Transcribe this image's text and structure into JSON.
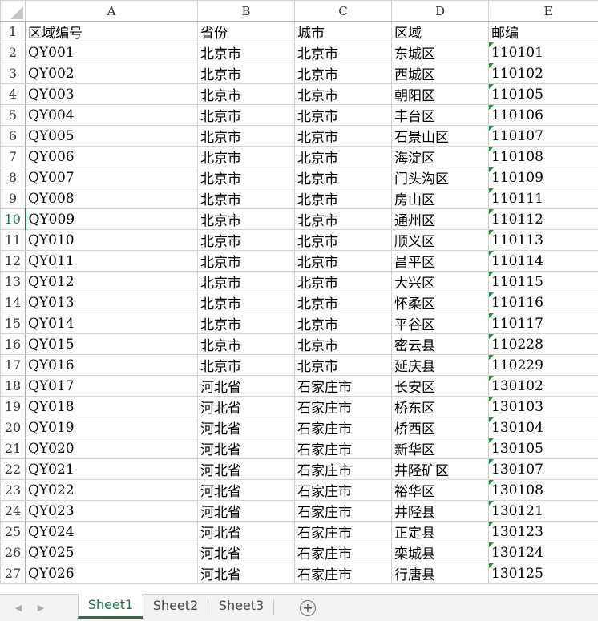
{
  "columns": [
    "A",
    "B",
    "C",
    "D",
    "E"
  ],
  "selected_row": "10",
  "rows": [
    {
      "num": "1",
      "cells": [
        "区域编号",
        "省份",
        "城市",
        "区域",
        "邮编"
      ]
    },
    {
      "num": "2",
      "cells": [
        "QY001",
        "北京市",
        "北京市",
        "东城区",
        "110101"
      ]
    },
    {
      "num": "3",
      "cells": [
        "QY002",
        "北京市",
        "北京市",
        "西城区",
        "110102"
      ]
    },
    {
      "num": "4",
      "cells": [
        "QY003",
        "北京市",
        "北京市",
        "朝阳区",
        "110105"
      ]
    },
    {
      "num": "5",
      "cells": [
        "QY004",
        "北京市",
        "北京市",
        "丰台区",
        "110106"
      ]
    },
    {
      "num": "6",
      "cells": [
        "QY005",
        "北京市",
        "北京市",
        "石景山区",
        "110107"
      ]
    },
    {
      "num": "7",
      "cells": [
        "QY006",
        "北京市",
        "北京市",
        "海淀区",
        "110108"
      ]
    },
    {
      "num": "8",
      "cells": [
        "QY007",
        "北京市",
        "北京市",
        "门头沟区",
        "110109"
      ]
    },
    {
      "num": "9",
      "cells": [
        "QY008",
        "北京市",
        "北京市",
        "房山区",
        "110111"
      ]
    },
    {
      "num": "10",
      "cells": [
        "QY009",
        "北京市",
        "北京市",
        "通州区",
        "110112"
      ]
    },
    {
      "num": "11",
      "cells": [
        "QY010",
        "北京市",
        "北京市",
        "顺义区",
        "110113"
      ]
    },
    {
      "num": "12",
      "cells": [
        "QY011",
        "北京市",
        "北京市",
        "昌平区",
        "110114"
      ]
    },
    {
      "num": "13",
      "cells": [
        "QY012",
        "北京市",
        "北京市",
        "大兴区",
        "110115"
      ]
    },
    {
      "num": "14",
      "cells": [
        "QY013",
        "北京市",
        "北京市",
        "怀柔区",
        "110116"
      ]
    },
    {
      "num": "15",
      "cells": [
        "QY014",
        "北京市",
        "北京市",
        "平谷区",
        "110117"
      ]
    },
    {
      "num": "16",
      "cells": [
        "QY015",
        "北京市",
        "北京市",
        "密云县",
        "110228"
      ]
    },
    {
      "num": "17",
      "cells": [
        "QY016",
        "北京市",
        "北京市",
        "延庆县",
        "110229"
      ]
    },
    {
      "num": "18",
      "cells": [
        "QY017",
        "河北省",
        "石家庄市",
        "长安区",
        "130102"
      ]
    },
    {
      "num": "19",
      "cells": [
        "QY018",
        "河北省",
        "石家庄市",
        "桥东区",
        "130103"
      ]
    },
    {
      "num": "20",
      "cells": [
        "QY019",
        "河北省",
        "石家庄市",
        "桥西区",
        "130104"
      ]
    },
    {
      "num": "21",
      "cells": [
        "QY020",
        "河北省",
        "石家庄市",
        "新华区",
        "130105"
      ]
    },
    {
      "num": "22",
      "cells": [
        "QY021",
        "河北省",
        "石家庄市",
        "井陉矿区",
        "130107"
      ]
    },
    {
      "num": "23",
      "cells": [
        "QY022",
        "河北省",
        "石家庄市",
        "裕华区",
        "130108"
      ]
    },
    {
      "num": "24",
      "cells": [
        "QY023",
        "河北省",
        "石家庄市",
        "井陉县",
        "130121"
      ]
    },
    {
      "num": "25",
      "cells": [
        "QY024",
        "河北省",
        "石家庄市",
        "正定县",
        "130123"
      ]
    },
    {
      "num": "26",
      "cells": [
        "QY025",
        "河北省",
        "石家庄市",
        "栾城县",
        "130124"
      ]
    },
    {
      "num": "27",
      "cells": [
        "QY026",
        "河北省",
        "石家庄市",
        "行唐县",
        "130125"
      ]
    }
  ],
  "sheet_tabs": [
    "Sheet1",
    "Sheet2",
    "Sheet3"
  ],
  "active_tab": "Sheet1",
  "icons": {
    "nav_prev": "triangle-left-icon",
    "nav_next": "triangle-right-icon",
    "add_sheet": "plus-circle-icon",
    "text_number_flag": "green-corner-triangle"
  },
  "colors": {
    "accent": "#217346",
    "gridline": "#d4d4d4",
    "error_flag": "#1e8a3e"
  }
}
